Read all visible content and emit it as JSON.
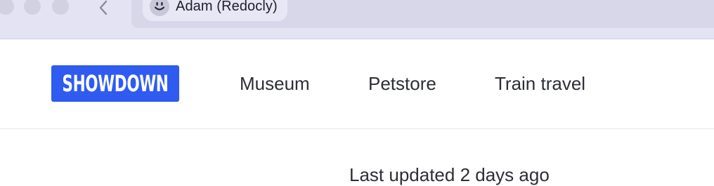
{
  "browser": {
    "profile_name": "Adam (Redocly)",
    "icons": {
      "back": "chevron-left-icon",
      "profile": "smiley-face-icon"
    }
  },
  "site": {
    "logo_text": "SHOWDOWN",
    "nav": [
      {
        "label": "Museum"
      },
      {
        "label": "Petstore"
      },
      {
        "label": "Train travel"
      }
    ],
    "partial_heading": "Last updated 2 days ago"
  },
  "colors": {
    "chrome_bg": "#e4e3f4",
    "logo_bg": "#2f5bf0",
    "nav_text": "#2d2f36"
  }
}
